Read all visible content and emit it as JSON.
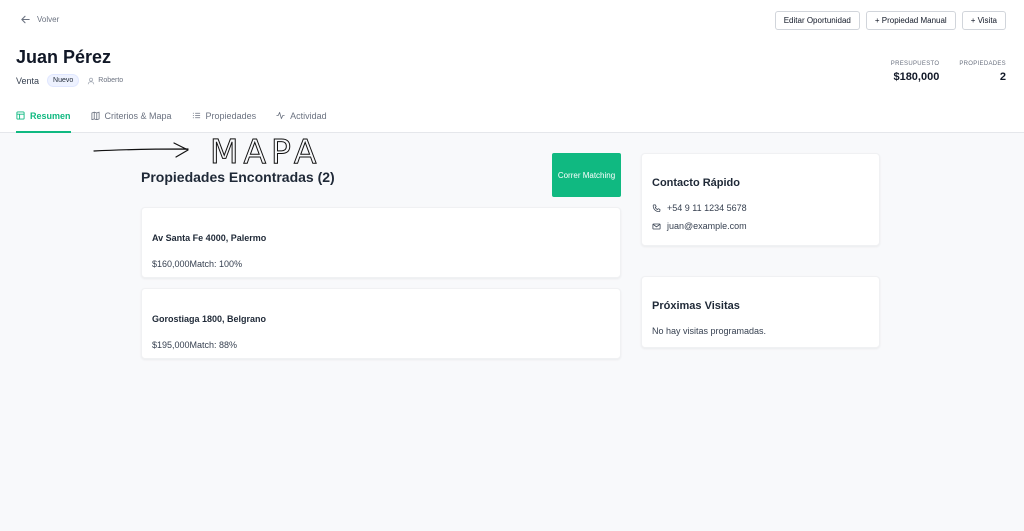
{
  "nav": {
    "back_label": "Volver"
  },
  "actions": {
    "edit_label": "Editar Oportunidad",
    "add_property_label": "+ Propiedad Manual",
    "add_visit_label": "+ Visita"
  },
  "client": {
    "name": "Juan Pérez",
    "operation": "Venta",
    "status": "Nuevo",
    "agent": "Roberto"
  },
  "stats": [
    {
      "label": "PRESUPUESTO",
      "value": "$180,000"
    },
    {
      "label": "PROPIEDADES",
      "value": "2"
    }
  ],
  "tabs": [
    {
      "label": "Resumen",
      "icon": "layout-icon",
      "active": true
    },
    {
      "label": "Criterios & Mapa",
      "icon": "map-icon",
      "active": false
    },
    {
      "label": "Propiedades",
      "icon": "list-icon",
      "active": false
    },
    {
      "label": "Actividad",
      "icon": "activity-icon",
      "active": false
    }
  ],
  "annotation": {
    "text": "MAPA"
  },
  "properties_section": {
    "title": "Propiedades Encontradas (2)",
    "run_button": "Correr Matching",
    "items": [
      {
        "address": "Av Santa Fe 4000, Palermo",
        "info": "$160,000Match: 100%"
      },
      {
        "address": "Gorostiaga 1800, Belgrano",
        "info": "$195,000Match: 88%"
      }
    ]
  },
  "contact": {
    "title": "Contacto Rápido",
    "phone": "+54 9 11 1234 5678",
    "email": "juan@example.com"
  },
  "visits": {
    "title": "Próximas Visitas",
    "empty": "No hay visitas programadas."
  },
  "colors": {
    "accent": "#10b981",
    "text": "#1f2937",
    "muted": "#6b7280"
  }
}
